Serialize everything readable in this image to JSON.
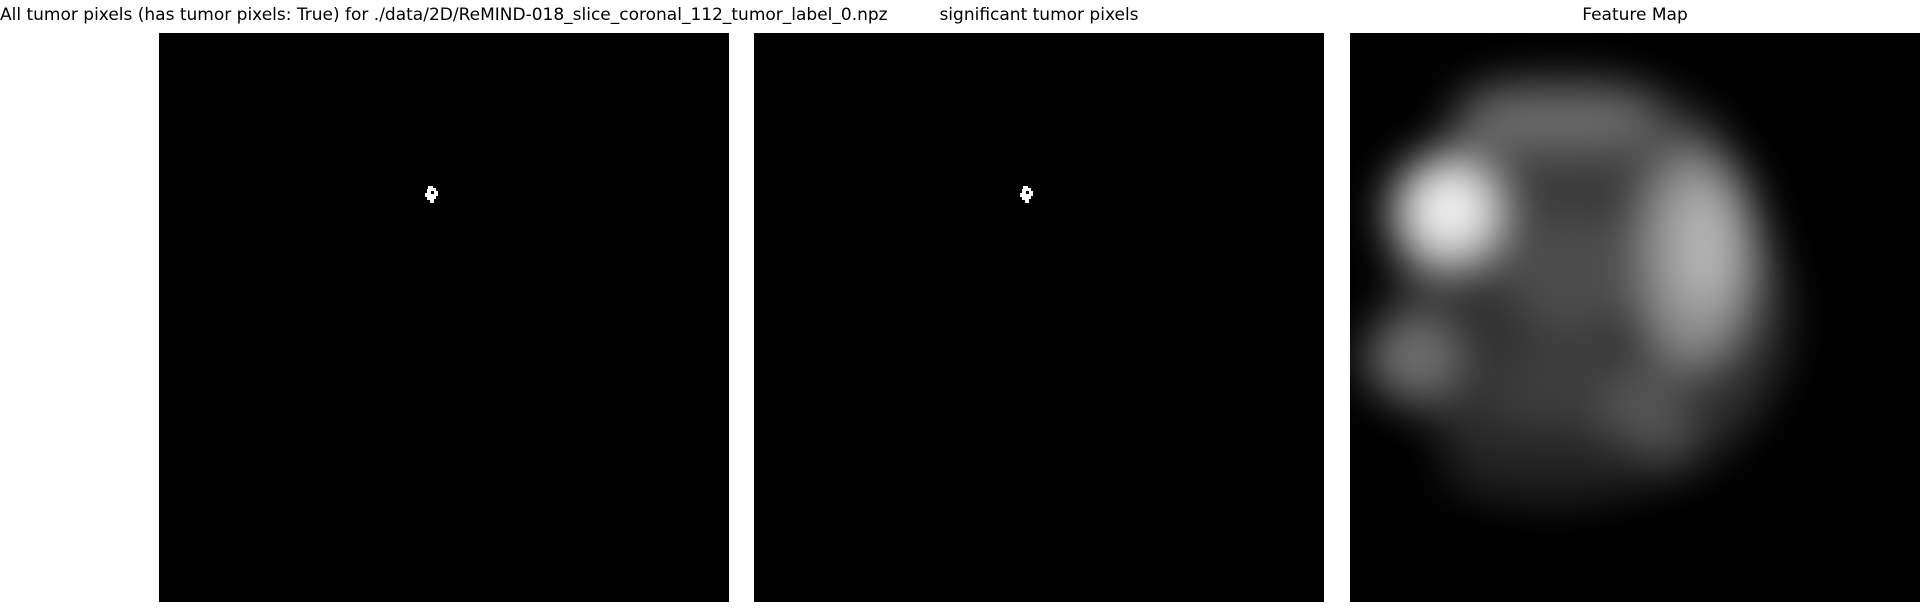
{
  "figure": {
    "panels": [
      {
        "title": "All tumor pixels (has tumor pixels: True) for ./data/2D/ReMIND-018_slice_coronal_112_tumor_label_0.npz",
        "kind": "binary-mask"
      },
      {
        "title": "significant tumor pixels",
        "kind": "binary-mask"
      },
      {
        "title": "Feature Map",
        "kind": "grayscale-heatmap"
      }
    ]
  }
}
